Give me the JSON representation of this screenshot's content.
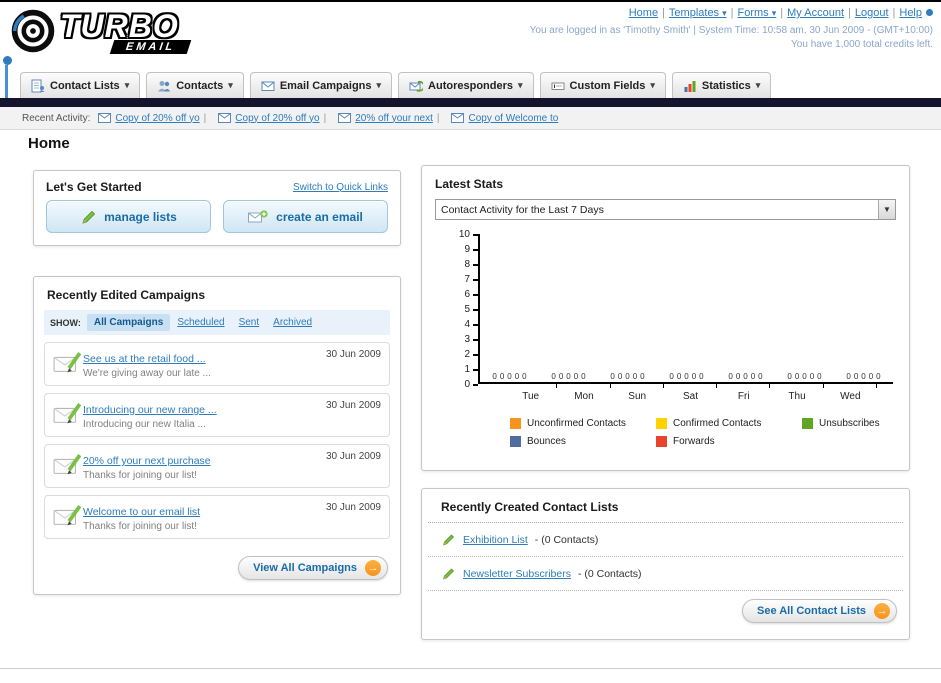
{
  "header": {
    "logo_main": "TURBO",
    "logo_sub": "EMAIL",
    "nav": {
      "home": "Home",
      "templates": "Templates",
      "forms": "Forms",
      "my_account": "My Account",
      "logout": "Logout",
      "help": "Help"
    },
    "login_info": "You are logged in as 'Timothy Smith' | System Time: 10:58 am, 30 Jun 2009 - (GMT+10:00)",
    "credits": "You have 1,000 total credits left."
  },
  "nav_tabs": [
    {
      "label": "Contact Lists"
    },
    {
      "label": "Contacts"
    },
    {
      "label": "Email Campaigns"
    },
    {
      "label": "Autoresponders"
    },
    {
      "label": "Custom Fields"
    },
    {
      "label": "Statistics"
    }
  ],
  "recent_activity": {
    "label": "Recent Activity:",
    "items": [
      {
        "text": "Copy of 20% off yo"
      },
      {
        "text": "Copy of 20% off yo"
      },
      {
        "text": "20% off your next"
      },
      {
        "text": "Copy of Welcome to"
      }
    ]
  },
  "page_title": "Home",
  "get_started": {
    "title": "Let's Get Started",
    "switch_link": "Switch to Quick Links",
    "manage_label": "manage lists",
    "create_label": "create an email"
  },
  "campaigns": {
    "title": "Recently Edited Campaigns",
    "show_label": "SHOW:",
    "filters": [
      {
        "label": "All Campaigns",
        "active": true
      },
      {
        "label": "Scheduled",
        "active": false
      },
      {
        "label": "Sent",
        "active": false
      },
      {
        "label": "Archived",
        "active": false
      }
    ],
    "items": [
      {
        "title": "See us at the retail food ...",
        "subtitle": "We're giving away our late ...",
        "date": "30 Jun 2009"
      },
      {
        "title": "Introducing our new range ...",
        "subtitle": "Introducing our new Italia ...",
        "date": "30 Jun 2009"
      },
      {
        "title": "20% off your next purchase",
        "subtitle": "Thanks for joining our list!",
        "date": "30 Jun 2009"
      },
      {
        "title": "Welcome to our email list",
        "subtitle": "Thanks for joining our list!",
        "date": "30 Jun 2009"
      }
    ],
    "view_all_label": "View All Campaigns"
  },
  "latest_stats": {
    "title": "Latest Stats",
    "dropdown_value": "Contact Activity for the Last 7 Days",
    "chart_data": {
      "type": "bar",
      "title": "Contact Activity for the Last 7 Days",
      "categories": [
        "Tue",
        "Mon",
        "Sun",
        "Sat",
        "Fri",
        "Thu",
        "Wed"
      ],
      "series": [
        {
          "name": "Unconfirmed Contacts",
          "color": "#f7941d",
          "values": [
            0,
            0,
            0,
            0,
            0,
            0,
            0
          ]
        },
        {
          "name": "Confirmed Contacts",
          "color": "#ffd200",
          "values": [
            0,
            0,
            0,
            0,
            0,
            0,
            0
          ]
        },
        {
          "name": "Unsubscribes",
          "color": "#61a521",
          "values": [
            0,
            0,
            0,
            0,
            0,
            0,
            0
          ]
        },
        {
          "name": "Bounces",
          "color": "#4f6d9f",
          "values": [
            0,
            0,
            0,
            0,
            0,
            0,
            0
          ]
        },
        {
          "name": "Forwards",
          "color": "#e8432b",
          "values": [
            0,
            0,
            0,
            0,
            0,
            0,
            0
          ]
        }
      ],
      "ylim": [
        0,
        10
      ],
      "yticks": [
        0,
        1,
        2,
        3,
        4,
        5,
        6,
        7,
        8,
        9,
        10
      ],
      "grid": false,
      "legend_position": "bottom",
      "data_labels": "0 shown above baseline for every series/day"
    }
  },
  "contact_lists": {
    "title": "Recently Created Contact Lists",
    "items": [
      {
        "name": "Exhibition List",
        "count": "- (0 Contacts)"
      },
      {
        "name": "Newsletter Subscribers",
        "count": "- (0 Contacts)"
      }
    ],
    "see_all_label": "See All Contact Lists"
  },
  "colors": {
    "accent_blue": "#2d7cbd",
    "dark_bar": "#14142e",
    "orange": "#f7941d"
  }
}
